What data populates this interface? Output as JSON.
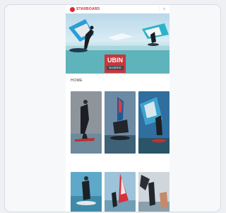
{
  "header": {
    "logo_icon": "brand-logo-icon",
    "logo_text": "STARBOARD",
    "icons_text": "⋮ ≡"
  },
  "hero": {
    "badge_title": "UBIN",
    "badge_subtitle": "BOARDS"
  },
  "section": {
    "label": "HOME"
  },
  "tiles": [
    {
      "name": "wing-foil-rider-photo"
    },
    {
      "name": "red-foil-jump-photo"
    },
    {
      "name": "blue-sky-wing-photo"
    },
    {
      "name": "sup-paddler-photo"
    },
    {
      "name": "red-sail-windsurf-photo"
    },
    {
      "name": "kite-rider-photo"
    }
  ],
  "colors": {
    "brand_red": "#e0262f"
  }
}
